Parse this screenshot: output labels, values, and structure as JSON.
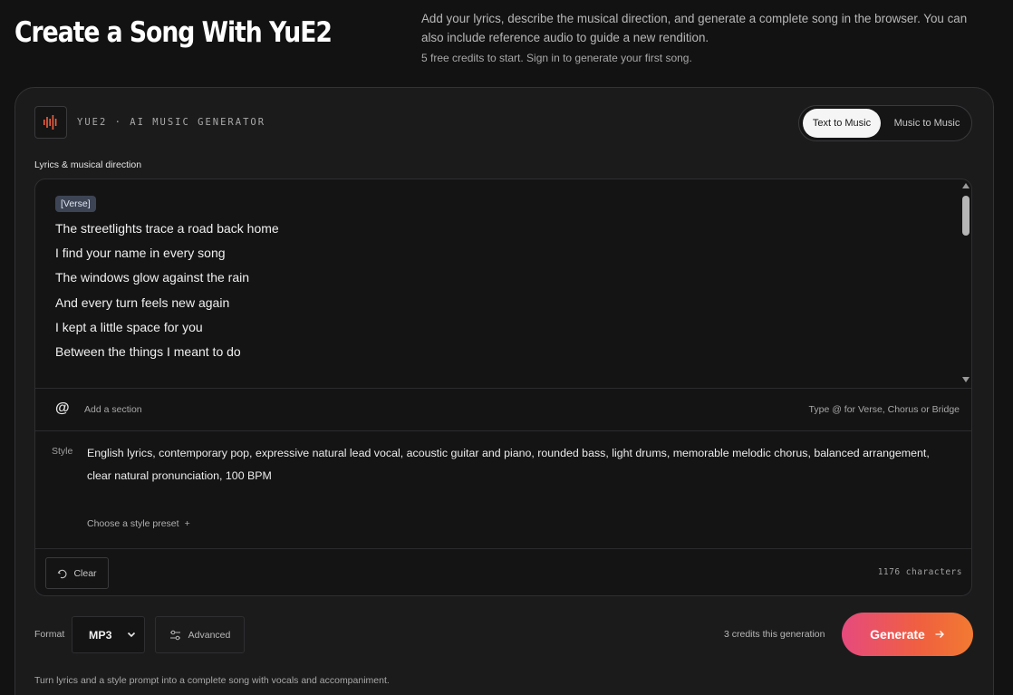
{
  "header": {
    "title": "Create a Song With YuE2",
    "intro": "Add your lyrics, describe the musical direction, and generate a complete song in the browser. You can also include reference audio to guide a new rendition.",
    "credits_note": "5 free credits to start. Sign in to generate your first song."
  },
  "card": {
    "brand": "YUE2 · AI MUSIC GENERATOR",
    "accent_color": "#f0603f",
    "modes": [
      {
        "label": "Text to Music",
        "active": true
      },
      {
        "label": "Music to Music",
        "active": false
      }
    ],
    "section_label": "Lyrics & musical direction",
    "lyrics": {
      "tag": "[Verse]",
      "lines": [
        "The streetlights trace a road back home",
        "I find your name in every song",
        "The windows glow against the rain",
        "And every turn feels new again",
        "I kept a little space for you",
        "Between the things I meant to do"
      ]
    },
    "section_bar": {
      "icon": "@",
      "add_label": "Add a section",
      "hint": "Type @ for Verse, Chorus or Bridge"
    },
    "style": {
      "label": "Style",
      "text": "English lyrics, contemporary pop, expressive natural lead vocal, acoustic guitar and piano, rounded bass, light drums, memorable melodic chorus, balanced arrangement, clear natural pronunciation, 100 BPM",
      "preset_label": "Choose a style preset",
      "preset_plus": "+"
    },
    "editor_footer": {
      "clear_label": "Clear",
      "char_count": "1176 characters"
    },
    "controls": {
      "format_label": "Format",
      "format_value": "MP3",
      "advanced_label": "Advanced",
      "cost_text": "3 credits this generation",
      "generate_label": "Generate"
    },
    "footer_note": "Turn lyrics and a style prompt into a complete song with vocals and accompaniment."
  }
}
